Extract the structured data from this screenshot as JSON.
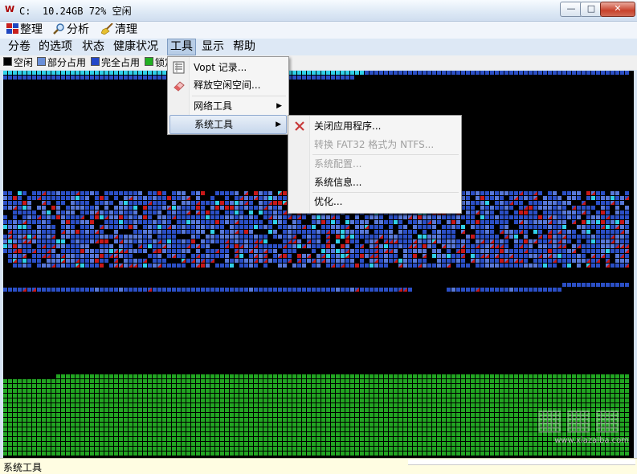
{
  "window": {
    "title": "C:  10.24GB 72% 空闲",
    "app_icon": "vopt-logo-icon",
    "minimize": "minimize-icon",
    "maximize": "maximize-icon",
    "close": "close-icon"
  },
  "toolbar": {
    "defrag_label": "整理",
    "analyze_label": "分析",
    "cleanup_label": "清理"
  },
  "menubar": {
    "items": [
      "分卷",
      "的选项",
      "状态",
      "健康状况",
      "工具",
      "显示",
      "帮助"
    ],
    "active_index": 4
  },
  "legend": {
    "items": [
      {
        "label": "空闲",
        "color": "#000000"
      },
      {
        "label": "部分占用",
        "color": "#6a8fd8"
      },
      {
        "label": "完全占用",
        "color": "#2347c8"
      },
      {
        "label": "锁定",
        "color": "#22b022"
      }
    ]
  },
  "tools_menu": {
    "items": [
      {
        "label": "Vopt 记录...",
        "icon": "log-icon"
      },
      {
        "label": "释放空闲空间...",
        "icon": "eraser-icon"
      },
      {
        "label": "网络工具",
        "submenu": true
      },
      {
        "label": "系统工具",
        "submenu": true,
        "highlighted": true
      }
    ]
  },
  "system_tools_menu": {
    "items": [
      {
        "label": "关闭应用程序...",
        "icon": "close-app-icon",
        "enabled": true
      },
      {
        "label": "转换 FAT32 格式为 NTFS...",
        "enabled": false
      },
      {
        "label": "系统配置...",
        "enabled": false
      },
      {
        "label": "系统信息...",
        "enabled": true
      },
      {
        "label": "优化...",
        "enabled": true
      }
    ]
  },
  "status": {
    "text": "系统工具"
  },
  "watermark": {
    "url": "www.xiazaiba.com"
  },
  "colors": {
    "free": "#000000",
    "partial": "#5878d8",
    "full": "#2b4fc6",
    "locked": "#22a522",
    "cyan": "#30d0e8",
    "fragment": "#c81818"
  }
}
